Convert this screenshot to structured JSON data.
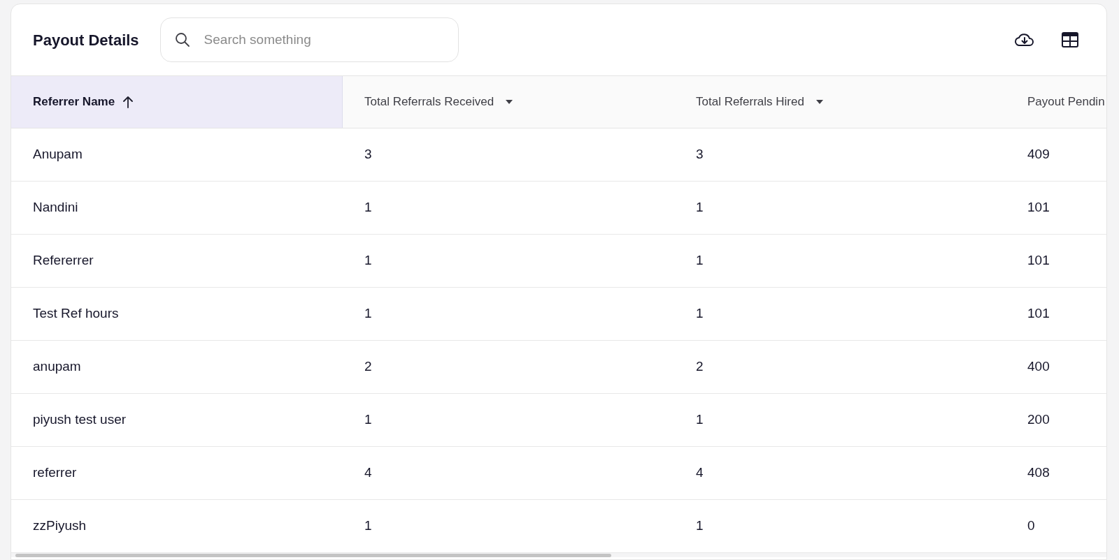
{
  "title": "Payout Details",
  "search": {
    "placeholder": "Search something"
  },
  "table": {
    "columns": [
      {
        "label": "Referrer Name",
        "selected": true,
        "kind": "sorted"
      },
      {
        "label": "Total Referrals Received",
        "selected": false,
        "kind": "dropdown"
      },
      {
        "label": "Total Referrals Hired",
        "selected": false,
        "kind": "dropdown"
      },
      {
        "label": "Payout Pendin",
        "selected": false,
        "kind": "plain"
      }
    ],
    "rows": [
      [
        "Anupam",
        "3",
        "3",
        "409"
      ],
      [
        "Nandini",
        "1",
        "1",
        "101"
      ],
      [
        "Refererrer",
        "1",
        "1",
        "101"
      ],
      [
        "Test Ref hours",
        "1",
        "1",
        "101"
      ],
      [
        "anupam",
        "2",
        "2",
        "400"
      ],
      [
        "piyush test user",
        "1",
        "1",
        "200"
      ],
      [
        "referrer",
        "4",
        "4",
        "408"
      ],
      [
        "zzPiyush",
        "1",
        "1",
        "0"
      ]
    ]
  }
}
